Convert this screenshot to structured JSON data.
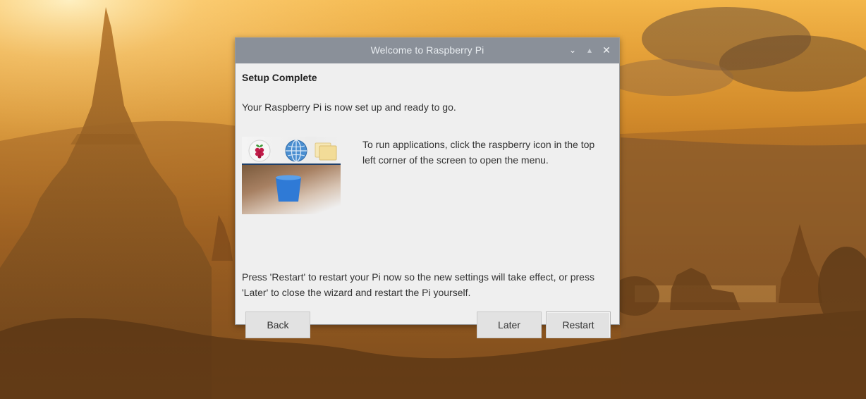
{
  "window": {
    "title": "Welcome to Raspberry Pi",
    "controls": {
      "minimize": "⌄",
      "maximize": "▴",
      "close": "✕"
    }
  },
  "page": {
    "heading": "Setup Complete",
    "subtitle": "Your Raspberry Pi is now set up and ready to go.",
    "instructions": "To run applications, click the raspberry icon in the top left corner of the screen to open the menu.",
    "restart_note": "Press 'Restart' to restart your Pi now so the new settings will take effect, or press 'Later' to close the wizard and restart the Pi yourself."
  },
  "buttons": {
    "back": "Back",
    "later": "Later",
    "restart": "Restart"
  },
  "preview_icons": [
    "raspberry-icon",
    "globe-icon",
    "folder-icon"
  ],
  "colors": {
    "titlebar": "#8a9099",
    "dialog_bg": "#efefef",
    "button_bg": "#e2e2e2"
  }
}
